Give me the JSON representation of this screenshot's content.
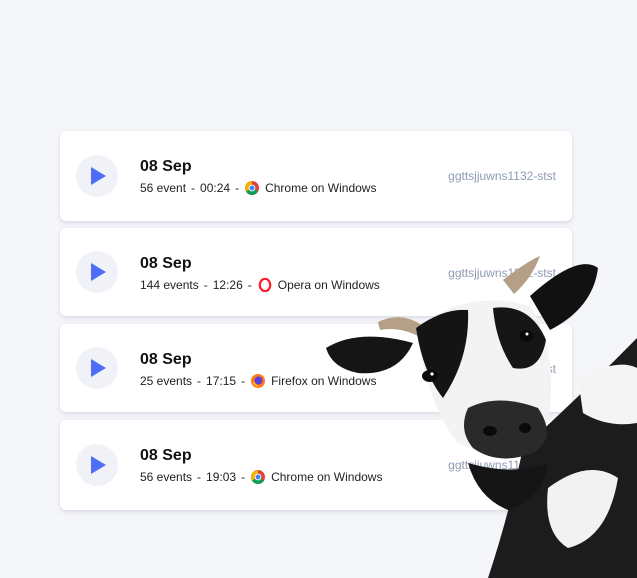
{
  "sessions": [
    {
      "date": "08 Sep",
      "events": "56 event",
      "time": "00:24",
      "browser": "Chrome on Windows",
      "browser_icon": "chrome-icon",
      "session_id": "ggttsjjuwns1132-stst"
    },
    {
      "date": "08 Sep",
      "events": "144 events",
      "time": "12:26",
      "browser": "Opera on Windows",
      "browser_icon": "opera-icon",
      "session_id": "ggttsjjuwns1132-stst"
    },
    {
      "date": "08 Sep",
      "events": "25 events",
      "time": "17:15",
      "browser": "Firefox on Windows",
      "browser_icon": "firefox-icon",
      "session_id": "ggttsjjuwns1132-stst"
    },
    {
      "date": "08 Sep",
      "events": "56 events",
      "time": "19:03",
      "browser": "Chrome on Windows",
      "browser_icon": "chrome-icon",
      "session_id": "ggttsjjuwns1132-stst"
    }
  ],
  "separator": "-",
  "colors": {
    "accent": "#4f6ef7",
    "background": "#f5f6fa",
    "muted": "#8f9bb3"
  }
}
